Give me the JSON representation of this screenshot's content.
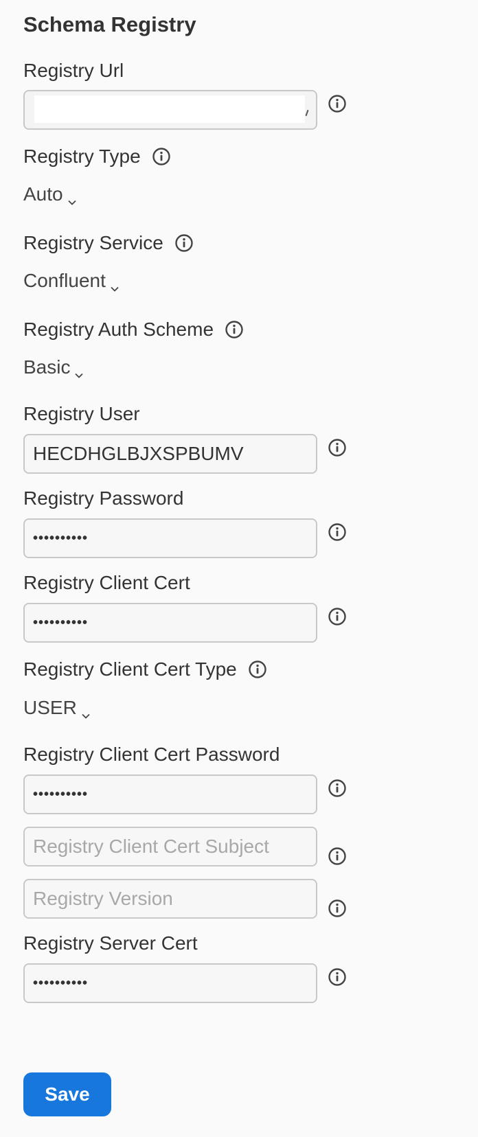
{
  "section": {
    "title": "Schema Registry"
  },
  "fields": {
    "registry_url": {
      "label": "Registry Url",
      "value": ""
    },
    "registry_type": {
      "label": "Registry Type",
      "value": "Auto"
    },
    "registry_service": {
      "label": "Registry Service",
      "value": "Confluent"
    },
    "registry_auth_scheme": {
      "label": "Registry Auth Scheme",
      "value": "Basic"
    },
    "registry_user": {
      "label": "Registry User",
      "value": "HECDHGLBJXSPBUMV"
    },
    "registry_password": {
      "label": "Registry Password",
      "value": "••••••••••"
    },
    "registry_client_cert": {
      "label": "Registry Client Cert",
      "value": "••••••••••"
    },
    "registry_client_cert_type": {
      "label": "Registry Client Cert Type",
      "value": "USER"
    },
    "registry_client_cert_password": {
      "label": "Registry Client Cert Password",
      "value": "••••••••••"
    },
    "registry_client_cert_subject": {
      "placeholder": "Registry Client Cert Subject"
    },
    "registry_version": {
      "placeholder": "Registry Version"
    },
    "registry_server_cert": {
      "label": "Registry Server Cert",
      "value": "••••••••••"
    }
  },
  "actions": {
    "save_label": "Save"
  },
  "icons": {
    "info": "info-circle-icon",
    "chevron": "chevron-down-icon"
  },
  "colors": {
    "primary": "#1777dd",
    "text": "#333333",
    "placeholder": "#a8a8a8",
    "border": "#c8c8c8"
  }
}
